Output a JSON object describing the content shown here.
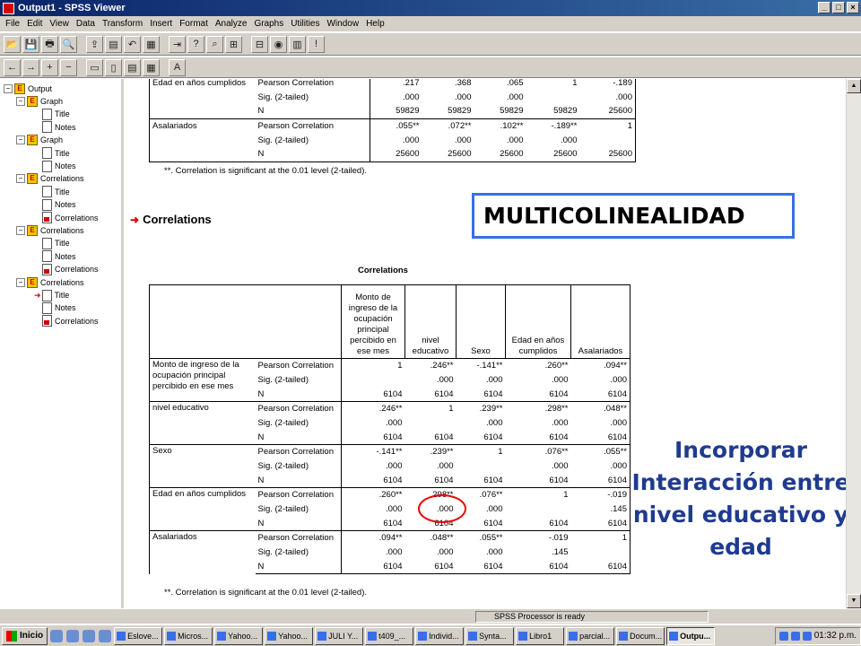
{
  "window": {
    "title": "Output1 - SPSS Viewer",
    "controls": [
      "_",
      "□",
      "×"
    ]
  },
  "menu": [
    "File",
    "Edit",
    "View",
    "Data",
    "Transform",
    "Insert",
    "Format",
    "Analyze",
    "Graphs",
    "Utilities",
    "Window",
    "Help"
  ],
  "toolbar1": [
    "open-icon",
    "save-icon",
    "print-icon",
    "print-preview-icon",
    "export-icon",
    "dialog-recall-icon",
    "undo-icon",
    "goto-data-icon",
    "goto-case-icon",
    "variables-icon",
    "find-icon",
    "insert-cases-icon",
    "insert-variable-icon",
    "select-cases-icon",
    "pivot-icon",
    "designate-window-icon"
  ],
  "toolbar2": [
    "promote-icon",
    "demote-icon",
    "expand-icon",
    "collapse-icon",
    "show-icon",
    "hide-icon",
    "insert-heading-icon",
    "insert-title-icon",
    "insert-text-icon"
  ],
  "outline": {
    "root": "Output",
    "items": [
      {
        "label": "Graph",
        "level": 1,
        "type": "book"
      },
      {
        "label": "Title",
        "level": 2,
        "type": "page"
      },
      {
        "label": "Notes",
        "level": 2,
        "type": "page"
      },
      {
        "label": "Graph",
        "level": 1,
        "type": "book"
      },
      {
        "label": "Title",
        "level": 2,
        "type": "page"
      },
      {
        "label": "Notes",
        "level": 2,
        "type": "page"
      },
      {
        "label": "Correlations",
        "level": 1,
        "type": "book"
      },
      {
        "label": "Title",
        "level": 2,
        "type": "page"
      },
      {
        "label": "Notes",
        "level": 2,
        "type": "page"
      },
      {
        "label": "Correlations",
        "level": 2,
        "type": "page-red"
      },
      {
        "label": "Correlations",
        "level": 1,
        "type": "book"
      },
      {
        "label": "Title",
        "level": 2,
        "type": "page"
      },
      {
        "label": "Notes",
        "level": 2,
        "type": "page"
      },
      {
        "label": "Correlations",
        "level": 2,
        "type": "page-red"
      },
      {
        "label": "Correlations",
        "level": 1,
        "type": "book"
      },
      {
        "label": "Title",
        "level": 2,
        "type": "page",
        "selected": true
      },
      {
        "label": "Notes",
        "level": 2,
        "type": "page"
      },
      {
        "label": "Correlations",
        "level": 2,
        "type": "page-red"
      }
    ]
  },
  "top_table": {
    "rows": [
      [
        "Edad en años cumplidos",
        "Pearson Correlation",
        ".217",
        ".368",
        ".065",
        "1",
        "-.189"
      ],
      [
        "",
        "Sig. (2-tailed)",
        ".000",
        ".000",
        ".000",
        "",
        ".000"
      ],
      [
        "",
        "N",
        "59829",
        "59829",
        "59829",
        "59829",
        "25600"
      ],
      [
        "Asalariados",
        "Pearson Correlation",
        ".055**",
        ".072**",
        ".102**",
        "-.189**",
        "1"
      ],
      [
        "",
        "Sig. (2-tailed)",
        ".000",
        ".000",
        ".000",
        ".000",
        ""
      ],
      [
        "",
        "N",
        "25600",
        "25600",
        "25600",
        "25600",
        "25600"
      ]
    ],
    "footnote": "**. Correlation is significant at the 0.01 level (2-tailed)."
  },
  "section_title": "Correlations",
  "main_table": {
    "caption": "Correlations",
    "headers": [
      "Monto de ingreso de la ocupación principal percibido en ese mes",
      "nivel educativo",
      "Sexo",
      "Edad en años cumplidos",
      "Asalariados"
    ],
    "groups": [
      {
        "label": "Monto de ingreso de la ocupación principal percibido en ese mes",
        "rows": [
          [
            "Pearson Correlation",
            "1",
            ".246**",
            "-.141**",
            ".260**",
            ".094**"
          ],
          [
            "Sig. (2-tailed)",
            "",
            ".000",
            ".000",
            ".000",
            ".000"
          ],
          [
            "N",
            "6104",
            "6104",
            "6104",
            "6104",
            "6104"
          ]
        ]
      },
      {
        "label": "nivel educativo",
        "rows": [
          [
            "Pearson Correlation",
            ".246**",
            "1",
            ".239**",
            ".298**",
            ".048**"
          ],
          [
            "Sig. (2-tailed)",
            ".000",
            "",
            ".000",
            ".000",
            ".000"
          ],
          [
            "N",
            "6104",
            "6104",
            "6104",
            "6104",
            "6104"
          ]
        ]
      },
      {
        "label": "Sexo",
        "rows": [
          [
            "Pearson Correlation",
            "-.141**",
            ".239**",
            "1",
            ".076**",
            ".055**"
          ],
          [
            "Sig. (2-tailed)",
            ".000",
            ".000",
            "",
            ".000",
            ".000"
          ],
          [
            "N",
            "6104",
            "6104",
            "6104",
            "6104",
            "6104"
          ]
        ]
      },
      {
        "label": "Edad en años cumplidos",
        "rows": [
          [
            "Pearson Correlation",
            ".260**",
            ".298**",
            ".076**",
            "1",
            "-.019"
          ],
          [
            "Sig. (2-tailed)",
            ".000",
            ".000",
            ".000",
            "",
            ".145"
          ],
          [
            "N",
            "6104",
            "6104",
            "6104",
            "6104",
            "6104"
          ]
        ]
      },
      {
        "label": "Asalariados",
        "rows": [
          [
            "Pearson Correlation",
            ".094**",
            ".048**",
            ".055**",
            "-.019",
            "1"
          ],
          [
            "Sig. (2-tailed)",
            ".000",
            ".000",
            ".000",
            ".145",
            ""
          ],
          [
            "N",
            "6104",
            "6104",
            "6104",
            "6104",
            "6104"
          ]
        ]
      }
    ],
    "footnote": "**. Correlation is significant at the 0.01 level (2-tailed)."
  },
  "annotations": {
    "multicolinealidad": "MULTICOLINEALIDAD",
    "incorporar": [
      "Incorporar",
      "Interacción entre",
      "nivel educativo y",
      "edad"
    ],
    "box_color": "#3a6ee8",
    "circle_color": "#e00000",
    "text_color": "#1f3b90"
  },
  "status": "SPSS Processor  is ready",
  "taskbar": {
    "start": "Inicio",
    "tasks": [
      "Eslove...",
      "Micros...",
      "Yahoo...",
      "Yahoo...",
      "JULI Y...",
      "t409_...",
      "Individ...",
      "Synta...",
      "Libro1",
      "parcial...",
      "Docum...",
      "Outpu..."
    ],
    "active_task": "Outpu...",
    "clock": "01:32 p.m."
  }
}
